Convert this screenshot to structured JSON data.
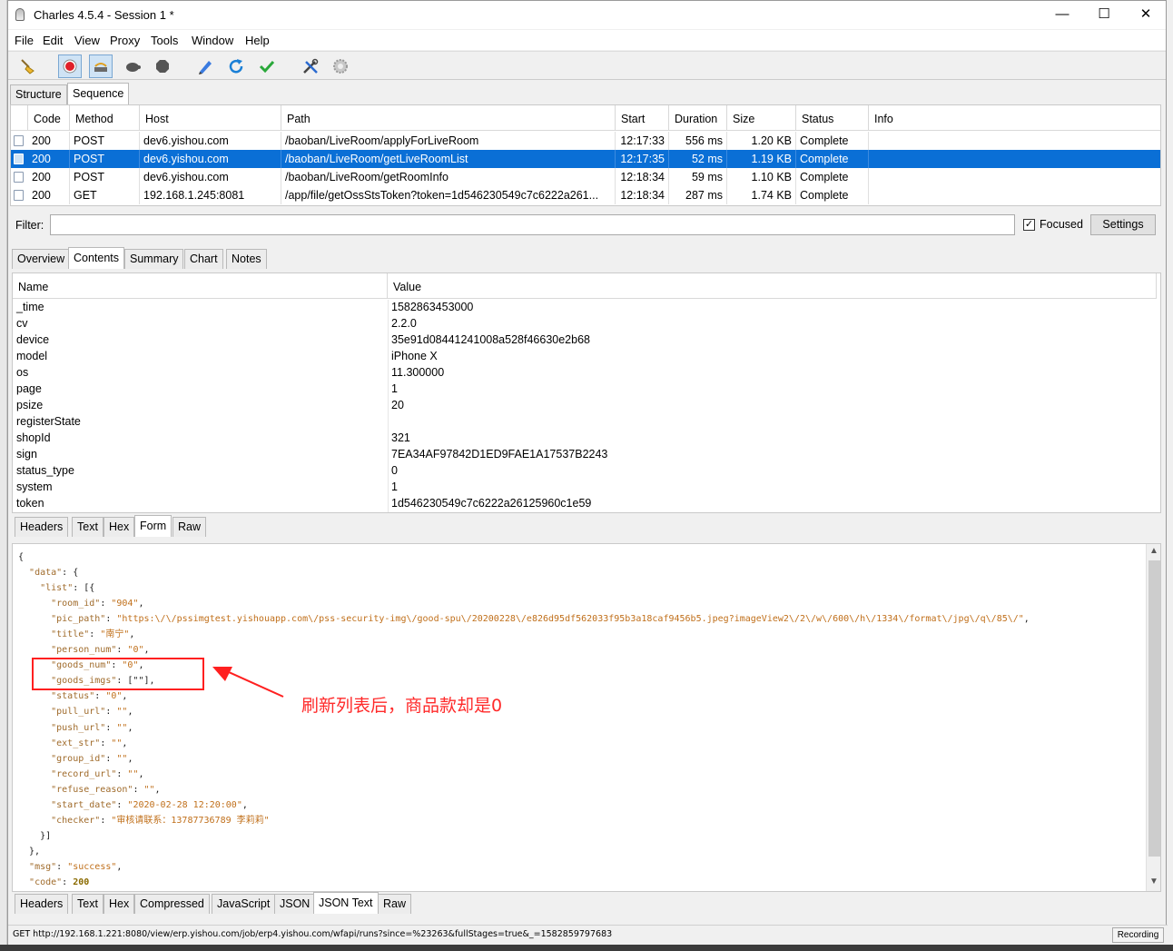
{
  "window": {
    "title": "Charles 4.5.4 - Session 1 *",
    "minimize": "—",
    "maximize": "☐",
    "close": "✕"
  },
  "menu": [
    "File",
    "Edit",
    "View",
    "Proxy",
    "Tools",
    "Window",
    "Help"
  ],
  "toolbar": {
    "icons": [
      "broom-icon",
      "record-icon",
      "throttle-icon",
      "turtle-icon",
      "stop-icon",
      "pen-icon",
      "refresh-icon",
      "check-icon",
      "tools-icon",
      "gear-icon"
    ],
    "active": [
      "record-icon",
      "throttle-icon"
    ]
  },
  "view_tabs": [
    "Structure",
    "Sequence"
  ],
  "view_tab_selected": "Sequence",
  "sequence": {
    "columns": [
      "Code",
      "Method",
      "Host",
      "Path",
      "Start",
      "Duration",
      "Size",
      "Status",
      "Info"
    ],
    "rows": [
      {
        "code": "200",
        "method": "POST",
        "host": "dev6.yishou.com",
        "path": "/baoban/LiveRoom/applyForLiveRoom",
        "start": "12:17:33",
        "duration": "556 ms",
        "size": "1.20 KB",
        "status": "Complete",
        "info": ""
      },
      {
        "code": "200",
        "method": "POST",
        "host": "dev6.yishou.com",
        "path": "/baoban/LiveRoom/getLiveRoomList",
        "start": "12:17:35",
        "duration": "52 ms",
        "size": "1.19 KB",
        "status": "Complete",
        "info": ""
      },
      {
        "code": "200",
        "method": "POST",
        "host": "dev6.yishou.com",
        "path": "/baoban/LiveRoom/getRoomInfo",
        "start": "12:18:34",
        "duration": "59 ms",
        "size": "1.10 KB",
        "status": "Complete",
        "info": ""
      },
      {
        "code": "200",
        "method": "GET",
        "host": "192.168.1.245:8081",
        "path": "/app/file/getOssStsToken?token=1d546230549c7c6222a261...",
        "start": "12:18:34",
        "duration": "287 ms",
        "size": "1.74 KB",
        "status": "Complete",
        "info": ""
      }
    ],
    "selected_row": 1
  },
  "filter": {
    "label": "Filter:",
    "value": "",
    "focused_label": "Focused",
    "focused_checked": true,
    "checkmark": "✓",
    "settings_label": "Settings"
  },
  "detail_tabs": [
    "Overview",
    "Contents",
    "Summary",
    "Chart",
    "Notes"
  ],
  "detail_tab_selected": "Contents",
  "form": {
    "columns": [
      "Name",
      "Value"
    ],
    "rows": [
      {
        "name": "_time",
        "value": "1582863453000"
      },
      {
        "name": "cv",
        "value": "2.2.0"
      },
      {
        "name": "device",
        "value": "35e91d08441241008a528f46630e2b68"
      },
      {
        "name": "model",
        "value": "iPhone X"
      },
      {
        "name": "os",
        "value": "11.300000"
      },
      {
        "name": "page",
        "value": "1"
      },
      {
        "name": "psize",
        "value": "20"
      },
      {
        "name": "registerState",
        "value": ""
      },
      {
        "name": "shopId",
        "value": "321"
      },
      {
        "name": "sign",
        "value": "7EA34AF97842D1ED9FAE1A17537B2243"
      },
      {
        "name": "status_type",
        "value": "0"
      },
      {
        "name": "system",
        "value": "1"
      },
      {
        "name": "token",
        "value": "1d546230549c7c6222a26125960c1e59"
      }
    ]
  },
  "request_tabs": [
    "Headers",
    "Text",
    "Hex",
    "Form",
    "Raw"
  ],
  "request_tab_selected": "Form",
  "json_lines": [
    "{",
    "  \"data\": {",
    "    \"list\": [{",
    "      \"room_id\": \"904\",",
    "      \"pic_path\": \"https:\\/\\/pssimgtest.yishouapp.com\\/pss-security-img\\/good-spu\\/20200228\\/e826d95df562033f95b3a18caf9456b5.jpeg?imageView2\\/2\\/w\\/600\\/h\\/1334\\/format\\/jpg\\/q\\/85\\/\",",
    "      \"title\": \"南宁\",",
    "      \"person_num\": \"0\",",
    "      \"goods_num\": \"0\",",
    "      \"goods_imgs\": [\"\"],",
    "      \"status\": \"0\",",
    "      \"pull_url\": \"\",",
    "      \"push_url\": \"\",",
    "      \"ext_str\": \"\",",
    "      \"group_id\": \"\",",
    "      \"record_url\": \"\",",
    "      \"refuse_reason\": \"\",",
    "      \"start_date\": \"2020-02-28 12:20:00\",",
    "      \"checker\": \"审核请联系：13787736789 李莉莉\"",
    "    }]",
    "  },",
    "  \"msg\": \"success\",",
    "  \"code\": 200"
  ],
  "response_tabs": [
    "Headers",
    "Text",
    "Hex",
    "Compressed",
    "JavaScript",
    "JSON",
    "JSON Text",
    "Raw"
  ],
  "response_tab_selected": "JSON Text",
  "annotation": {
    "text": "刷新列表后，商品款却是0",
    "color": "#ff2a2a"
  },
  "statusbar": {
    "url": "GET http://192.168.1.221:8080/view/erp.yishou.com/job/erp4.yishou.com/wfapi/runs?since=%23263&fullStages=true&_=1582859797683",
    "recording_label": "Recording"
  }
}
